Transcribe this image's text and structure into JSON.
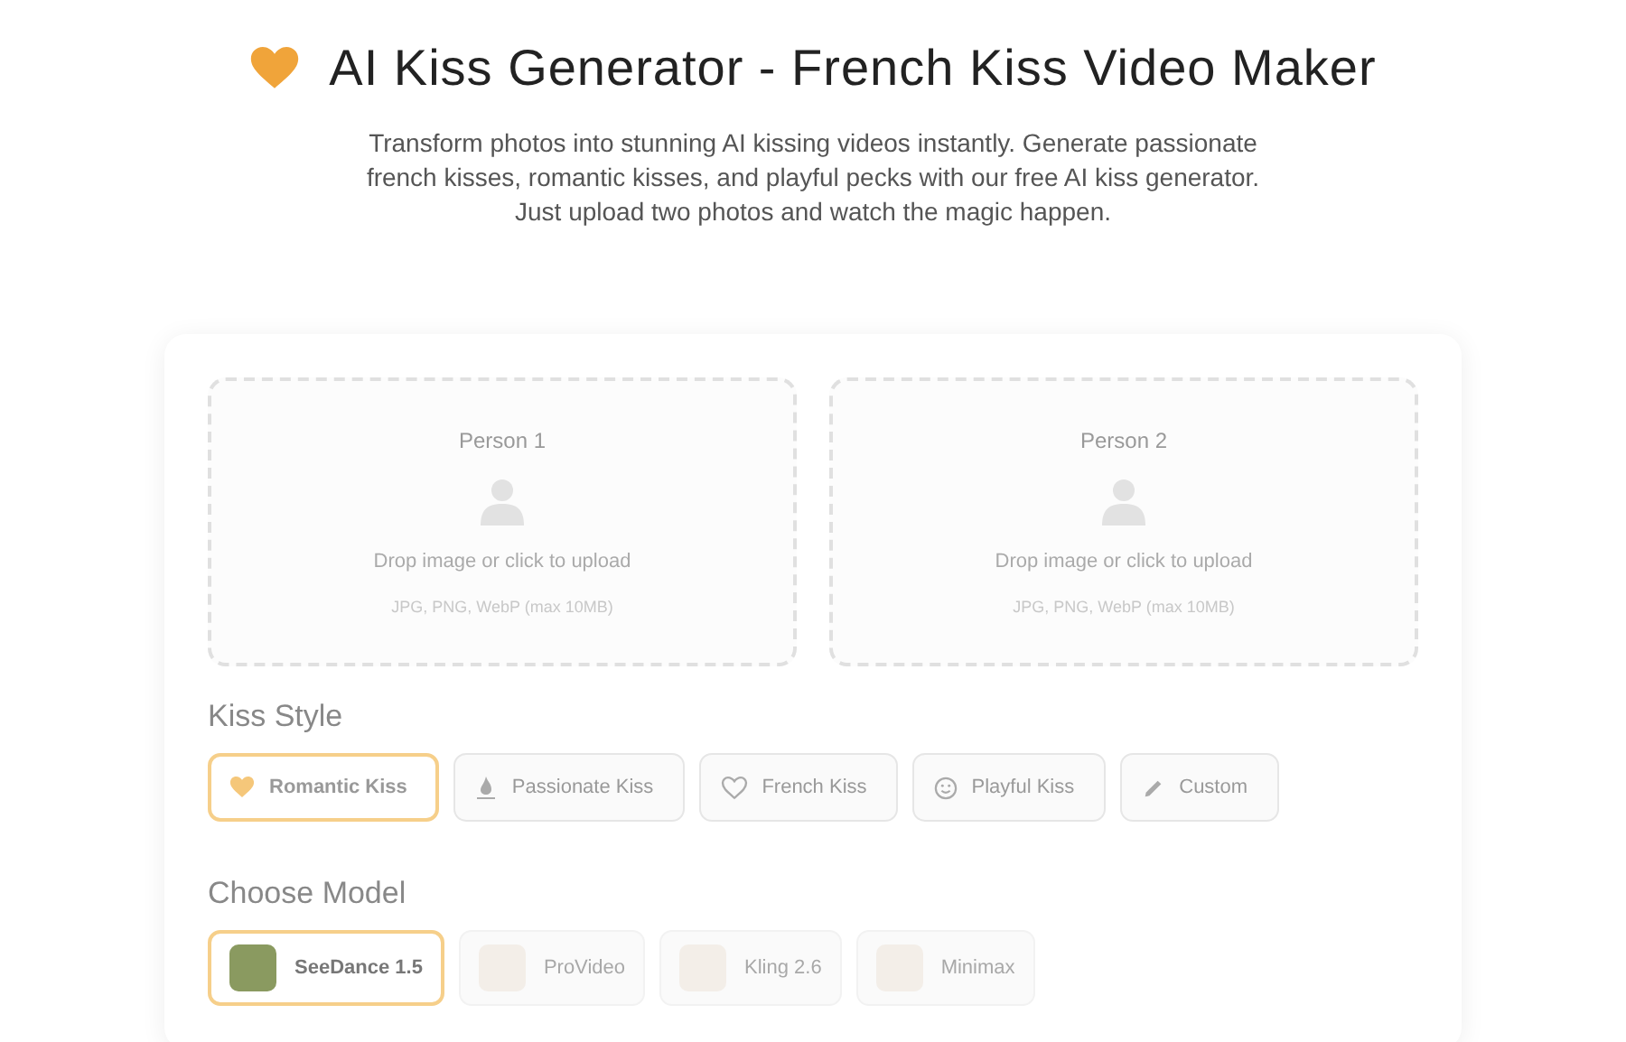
{
  "header": {
    "title": "AI Kiss Generator - French Kiss Video Maker",
    "description": "Transform photos into stunning AI kissing videos instantly. Generate passionate french kisses, romantic kisses, and playful pecks with our free AI kiss generator. Just upload two photos and watch the magic happen."
  },
  "uploads": [
    {
      "label": "Person 1",
      "prompt": "Drop image or click to upload",
      "hint": "JPG, PNG, WebP (max 10MB)"
    },
    {
      "label": "Person 2",
      "prompt": "Drop image or click to upload",
      "hint": "JPG, PNG, WebP (max 10MB)"
    }
  ],
  "kiss_style": {
    "heading": "Kiss Style",
    "options": [
      {
        "label": "Romantic Kiss",
        "selected": true
      },
      {
        "label": "Passionate Kiss",
        "selected": false
      },
      {
        "label": "French Kiss",
        "selected": false
      },
      {
        "label": "Playful Kiss",
        "selected": false
      },
      {
        "label": "Custom",
        "selected": false
      }
    ]
  },
  "model": {
    "heading": "Choose Model",
    "options": [
      {
        "label": "SeeDance 1.5",
        "selected": true,
        "disabled": false
      },
      {
        "label": "ProVideo",
        "selected": false,
        "disabled": true
      },
      {
        "label": "Kling 2.6",
        "selected": false,
        "disabled": true
      },
      {
        "label": "Minimax",
        "selected": false,
        "disabled": true
      }
    ]
  }
}
